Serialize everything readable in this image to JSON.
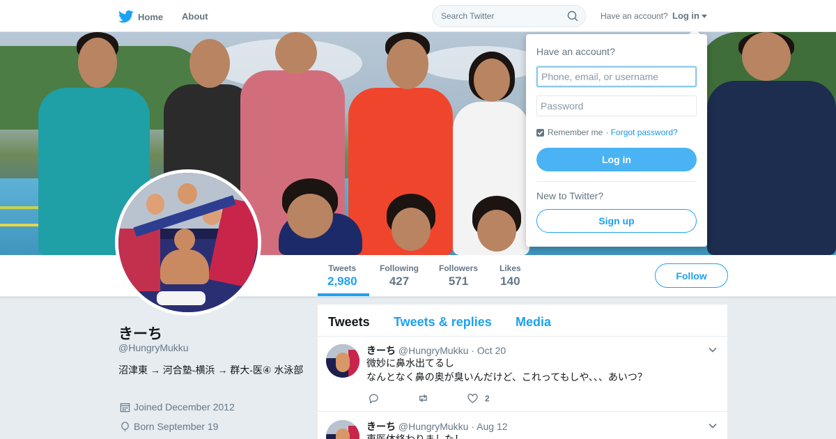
{
  "topbar": {
    "home_label": "Home",
    "about_label": "About",
    "search_placeholder": "Search Twitter",
    "have_account": "Have an account?",
    "login_label": "Log in"
  },
  "profile_nav": {
    "stats": [
      {
        "label": "Tweets",
        "value": "2,980",
        "active": true
      },
      {
        "label": "Following",
        "value": "427"
      },
      {
        "label": "Followers",
        "value": "571"
      },
      {
        "label": "Likes",
        "value": "140"
      }
    ],
    "follow_label": "Follow"
  },
  "profile": {
    "name": "きーち",
    "handle": "@HungryMukku",
    "bio": "沼津東 → 河合塾-横浜 → 群大-医④ 水泳部",
    "joined": "Joined December 2012",
    "born": "Born September 19"
  },
  "timeline": {
    "tabs": [
      "Tweets",
      "Tweets & replies",
      "Media"
    ],
    "tweets": [
      {
        "name": "きーち",
        "handle": "@HungryMukku",
        "date": "· Oct 20",
        "lines": [
          "微妙に鼻水出てるし",
          "なんとなく鼻の奥が臭いんだけど、これってもしや、、、あいつ？"
        ],
        "likes": "2"
      },
      {
        "name": "きーち",
        "handle": "@HungryMukku",
        "date": "· Aug 12",
        "lines": [
          "東医体終わりました！"
        ]
      }
    ]
  },
  "login_dropdown": {
    "title": "Have an account?",
    "username_placeholder": "Phone, email, or username",
    "password_placeholder": "Password",
    "remember_label": "Remember me",
    "forgot_label": "· Forgot password?",
    "login_button": "Log in",
    "new_label": "New to Twitter?",
    "signup_button": "Sign up"
  },
  "colors": {
    "accent": "#1da1f2",
    "login_button": "#4ab3f4",
    "background": "#e6ecf0"
  }
}
